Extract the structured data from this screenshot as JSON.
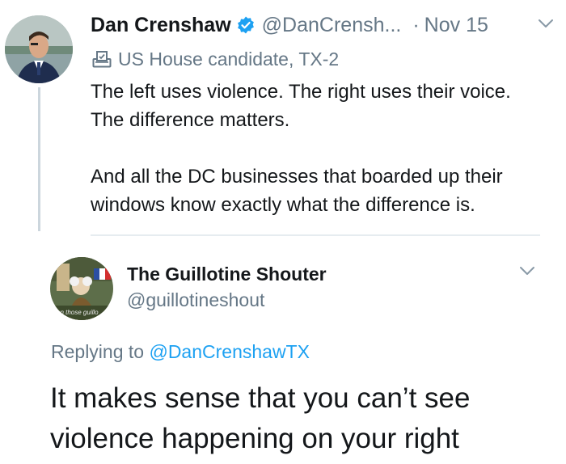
{
  "original_tweet": {
    "author_name": "Dan Crenshaw",
    "handle": "@DanCrensh...",
    "separator": "·",
    "date": "Nov 15",
    "label": "US House candidate, TX-2",
    "text_1": "The left uses violence. The right uses their voice. The difference matters.",
    "text_2": "And all the DC businesses that boarded up their windows know exactly what the difference is."
  },
  "reply_tweet": {
    "author_name": "The Guillotine Shouter",
    "handle": "@guillotineshout",
    "avatar_caption": "on those guillo",
    "replying_prefix": "Replying to",
    "replying_handle": "@DanCrenshawTX",
    "text": "It makes sense that you can’t see violence happening on your right"
  },
  "icons": {
    "verified": "verified-badge-icon",
    "ballot": "ballot-box-icon",
    "chevron": "chevron-down-icon"
  },
  "colors": {
    "link": "#1da1f2",
    "muted": "#657786",
    "text": "#14171a"
  }
}
